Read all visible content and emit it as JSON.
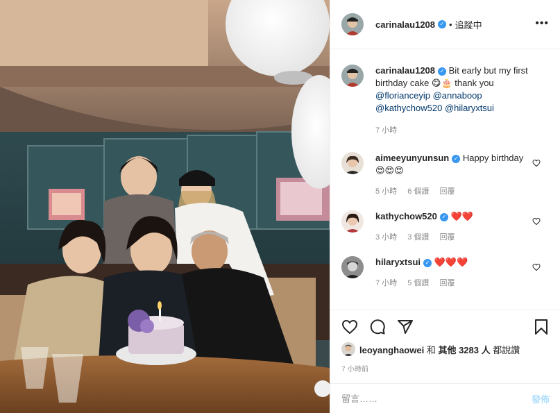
{
  "post": {
    "username": "carinalau1208",
    "verified": true,
    "follow_status": "追蹤中",
    "more_icon": "more-horizontal-icon"
  },
  "caption": {
    "username": "carinalau1208",
    "text": "Bit early but my first birthday cake 😋🎂 thank you",
    "mentions": [
      "@florianceyip",
      "@annaboop",
      "@kathychow520",
      "@hilaryxtsui"
    ],
    "time": "7 小時"
  },
  "comments": [
    {
      "username": "aimeeyunyunsun",
      "verified": true,
      "text": "Happy birthday 😍😍😍",
      "time": "5 小時",
      "likes": "6 個讚",
      "reply": "回覆"
    },
    {
      "username": "kathychow520",
      "verified": true,
      "text": "❤️❤️",
      "time": "3 小時",
      "likes": "3 個讚",
      "reply": "回覆"
    },
    {
      "username": "hilaryxtsui",
      "verified": true,
      "text": "❤️❤️❤️",
      "time": "7 小時",
      "likes": "5 個讚",
      "reply": "回覆"
    }
  ],
  "actions": {
    "like_icon": "heart-icon",
    "comment_icon": "comment-icon",
    "share_icon": "send-icon",
    "save_icon": "bookmark-icon"
  },
  "likes": {
    "liker": "leoyanghaowei",
    "text_and": "和",
    "text_others": "其他 3283 人",
    "text_suffix": "都說讚"
  },
  "posted_ago": "7 小時前",
  "add_comment": {
    "placeholder": "留言……",
    "post_label": "發佈"
  }
}
